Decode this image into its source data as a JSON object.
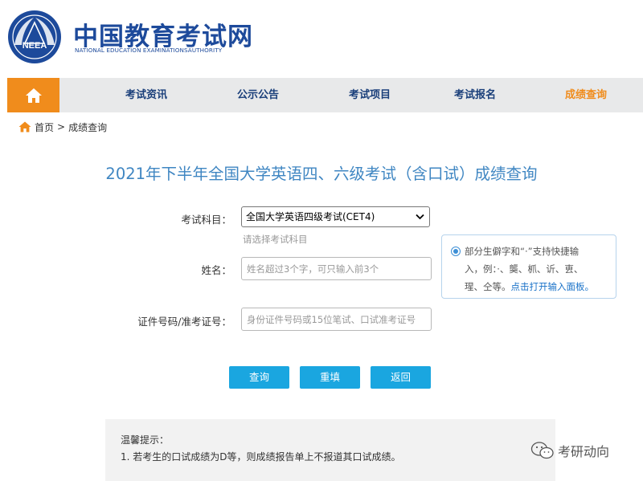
{
  "header": {
    "logo_emblem_text": "NEEA",
    "title_cn": "中国教育考试网",
    "title_en": "NATIONAL EDUCATION EXAMINATIONSAUTHORITY"
  },
  "nav": {
    "home_icon": "home-icon",
    "items": [
      {
        "label": "考试资讯"
      },
      {
        "label": "公示公告"
      },
      {
        "label": "考试项目"
      },
      {
        "label": "考试报名"
      },
      {
        "label": "成绩查询",
        "active": true
      }
    ]
  },
  "breadcrumb": {
    "home": "首页",
    "separator": ">",
    "current": "成绩查询"
  },
  "page_title": "2021年下半年全国大学英语四、六级考试（含口试）成绩查询",
  "form": {
    "subject_label": "考试科目：",
    "subject_value": "全国大学英语四级考试(CET4)",
    "subject_hint": "请选择考试科目",
    "name_label": "姓名：",
    "name_placeholder": "姓名超过3个字，可只输入前3个",
    "id_label": "证件号码/准考证号：",
    "id_placeholder": "身份证件号码或15位笔试、口试准考证号"
  },
  "tip": {
    "line1": "部分生僻字和“·”支持快捷输",
    "line2": "入，例：·、龑、枛、䜣、叀、",
    "line3_prefix": "瑆、仝等。",
    "line3_link": "点击打开输入面板。"
  },
  "buttons": {
    "query": "查询",
    "reset": "重填",
    "back": "返回"
  },
  "notice": {
    "title": "温馨提示：",
    "item1": "1. 若考生的口试成绩为D等，则成绩报告单上不报道其口试成绩。"
  },
  "watermark": {
    "text": "考研动向",
    "icon": "wechat-icon"
  },
  "colors": {
    "brand_blue": "#1d4a9b",
    "nav_orange": "#f08c1c",
    "title_blue": "#3f86c2",
    "button_blue": "#1aa6e0"
  }
}
